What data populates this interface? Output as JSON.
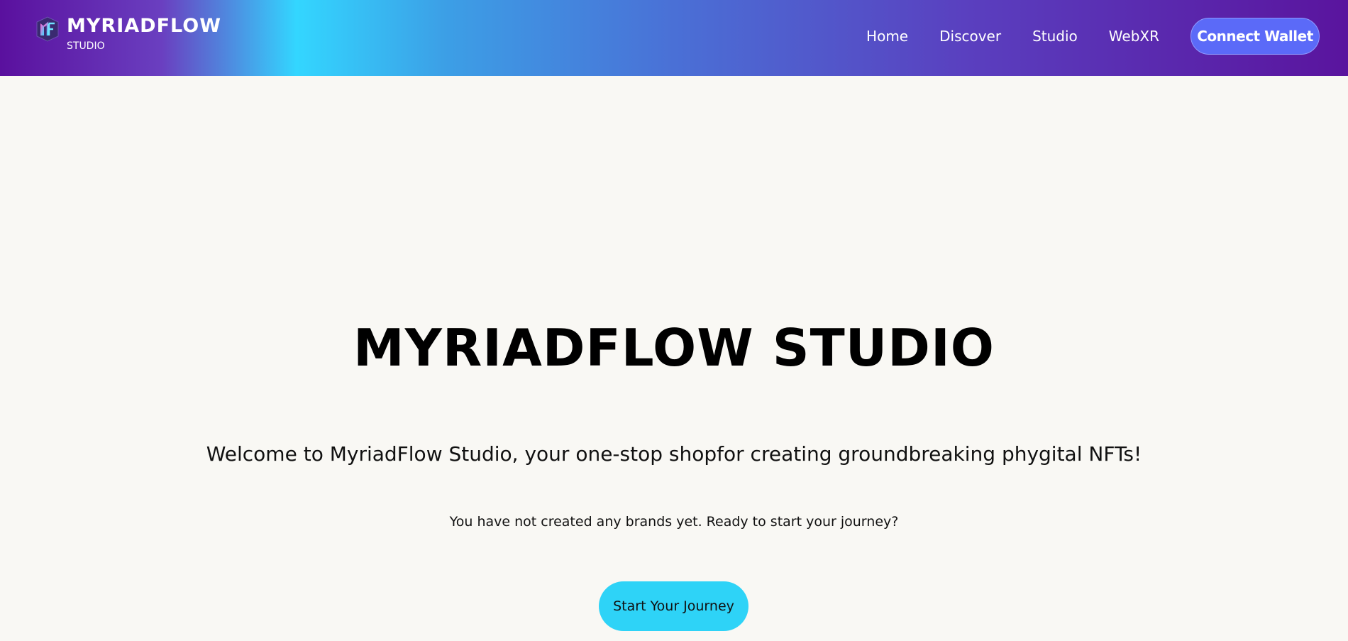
{
  "header": {
    "brand_name": "MYRIADFLOW",
    "brand_sub": "STUDIO",
    "logo_icon": "mf-logo-icon",
    "nav": [
      {
        "label": "Home"
      },
      {
        "label": "Discover"
      },
      {
        "label": "Studio"
      },
      {
        "label": "WebXR"
      }
    ],
    "connect_label": "Connect Wallet"
  },
  "hero": {
    "title": "MYRIADFLOW STUDIO",
    "welcome": "Welcome to MyriadFlow Studio, your one-stop shopfor creating groundbreaking phygital NFTs!",
    "notice": "You have not created any brands yet. Ready to start your journey?",
    "cta_label": "Start Your Journey"
  },
  "colors": {
    "accent_cyan": "#2ed3f7",
    "connect_button": "#5b6af8",
    "header_purple": "#5a149e",
    "background": "#f9f8f4"
  }
}
